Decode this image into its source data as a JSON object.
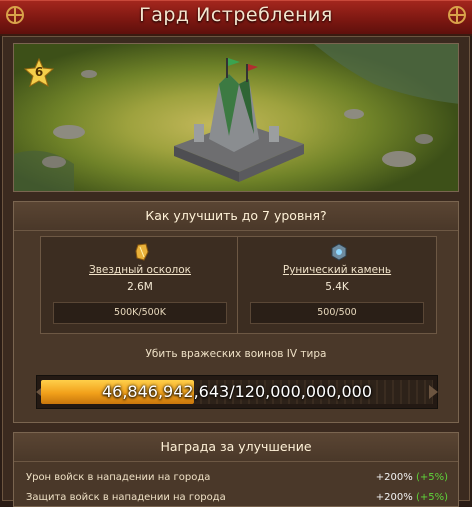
{
  "window": {
    "title": "Гард Истребления"
  },
  "building": {
    "level": "6"
  },
  "upgrade": {
    "header": "Как улучшить до 7 уровня?",
    "resources": [
      {
        "name": "Звездный осколок",
        "amount": "2.6M",
        "progress": "500K/500K",
        "icon": "star-shard-icon",
        "fill_fraction": 1.0
      },
      {
        "name": "Рунический камень",
        "amount": "5.4K",
        "progress": "500/500",
        "icon": "rune-stone-icon",
        "fill_fraction": 1.0
      }
    ],
    "kill_requirement": "Убить вражеских воинов IV тира",
    "kill_progress_text": "46,846,942,643/120,000,000,000",
    "kill_progress_fraction": 0.39
  },
  "reward": {
    "header": "Награда за улучшение",
    "rows": [
      {
        "label": "Урон войск в нападении на города",
        "value": "+200%",
        "bonus": "(+5%)"
      },
      {
        "label": "Защита войск в нападении на города",
        "value": "+200%",
        "bonus": "(+5%)"
      }
    ]
  },
  "colors": {
    "titlebar": "#8b1c15",
    "progress_fill": "#f1a01a",
    "bonus_green": "#5fd43a"
  }
}
